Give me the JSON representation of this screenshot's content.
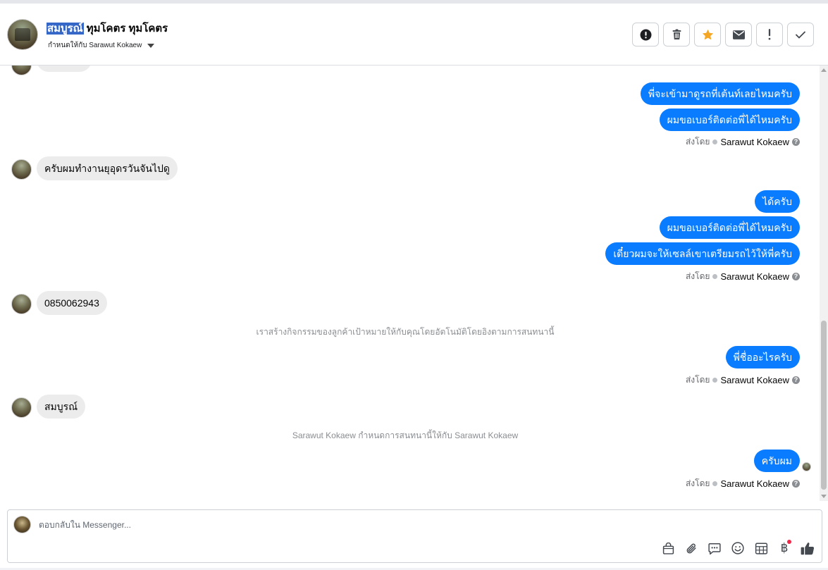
{
  "header": {
    "name_highlight": "สมบูรณ์",
    "name_rest": " ทุมโคตร ทุมโคตร",
    "assigned_label": "กำหนดให้กับ Sarawut Kokaew",
    "actions": [
      {
        "icon": "alert-circle-icon",
        "color": "#1c1e21"
      },
      {
        "icon": "trash-icon",
        "color": "#444950"
      },
      {
        "icon": "star-icon",
        "color": "#f5a623"
      },
      {
        "icon": "envelope-icon",
        "color": "#444950"
      },
      {
        "icon": "exclamation-icon",
        "color": "#444950"
      },
      {
        "icon": "check-icon",
        "color": "#444950"
      }
    ]
  },
  "conversation": {
    "outgoing_1": [
      "พี่จะเข้ามาดูรถที่เต้นท์เลยไหมครับ",
      "ผมขอเบอร์ติดต่อพี่ได้ไหมครับ"
    ],
    "incoming_1": "ครับผมทำงานยุอุดรวันจันไปดู",
    "outgoing_2": [
      "ได้ครับ",
      "ผมขอเบอร์ติดต่อพี่ได้ไหมครับ",
      "เดี๋ยวผมจะให้เซลล์เขาเตรียมรถไว้ให้พี่ครับ"
    ],
    "incoming_2": "0850062943",
    "system_1": "เราสร้างกิจกรรมของลูกค้าเป้าหมายให้กับคุณโดยอัตโนมัติโดยอิงตามการสนทนานี้",
    "outgoing_3": "พี่ชื่ออะไรครับ",
    "incoming_3": "สมบูรณ์",
    "system_2": "Sarawut Kokaew กำหนดการสนทนานี้ให้กับ Sarawut Kokaew",
    "outgoing_4": "ครับผม",
    "sent_by_prefix": "ส่งโดย",
    "sent_by_name": "Sarawut Kokaew"
  },
  "composer": {
    "placeholder": "ตอบกลับใน Messenger...",
    "tools": [
      "shopping-bag-icon",
      "paperclip-icon",
      "saved-reply-icon",
      "emoji-icon",
      "calendar-icon",
      "baht-icon",
      "like-icon"
    ]
  },
  "colors": {
    "outgoing_bubble": "#0a7cff",
    "incoming_bubble": "#ececec",
    "highlight": "#3567c8"
  }
}
